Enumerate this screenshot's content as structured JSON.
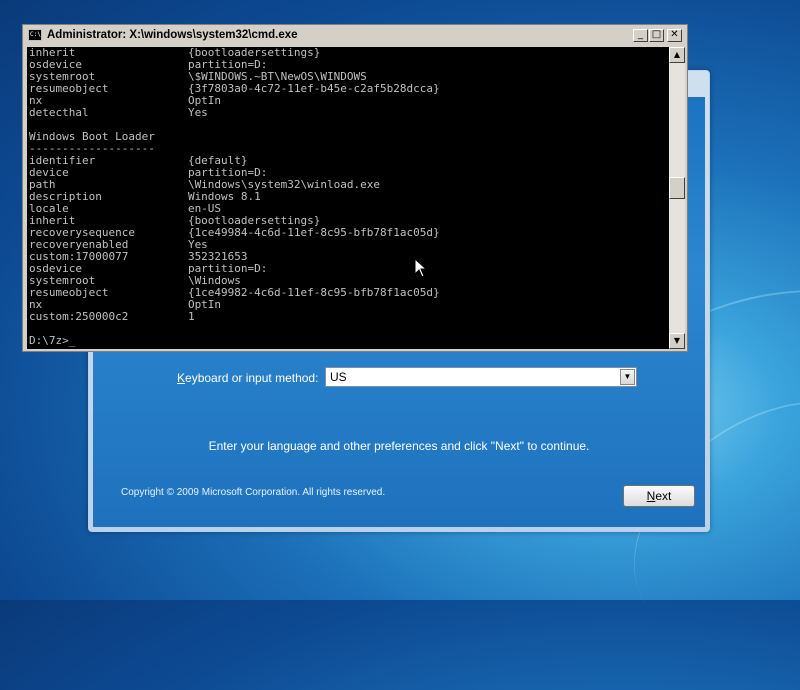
{
  "cmd_window": {
    "title": "Administrator: X:\\windows\\system32\\cmd.exe",
    "icon_text": "C:\\",
    "controls": {
      "minimize": "_",
      "maximize": "□",
      "close": "✕"
    },
    "scroll_up": "▲",
    "scroll_down": "▼",
    "lines": [
      "inherit                 {bootloadersettings}",
      "osdevice                partition=D:",
      "systemroot              \\$WINDOWS.~BT\\NewOS\\WINDOWS",
      "resumeobject            {3f7803a0-4c72-11ef-b45e-c2af5b28dcca}",
      "nx                      OptIn",
      "detecthal               Yes",
      "",
      "Windows Boot Loader",
      "-------------------",
      "identifier              {default}",
      "device                  partition=D:",
      "path                    \\Windows\\system32\\winload.exe",
      "description             Windows 8.1",
      "locale                  en-US",
      "inherit                 {bootloadersettings}",
      "recoverysequence        {1ce49984-4c6d-11ef-8c95-bfb78f1ac05d}",
      "recoveryenabled         Yes",
      "custom:17000077         352321653",
      "osdevice                partition=D:",
      "systemroot              \\Windows",
      "resumeobject            {1ce49982-4c6d-11ef-8c95-bfb78f1ac05d}",
      "nx                      OptIn",
      "custom:250000c2         1",
      "",
      "D:\\7z>_"
    ]
  },
  "setup_window": {
    "keyboard_label_prefix": "K",
    "keyboard_label_rest": "eyboard or input method:",
    "keyboard_value": "US",
    "dropdown_arrow": "▼",
    "hint": "Enter your language and other preferences and click \"Next\" to continue.",
    "copyright": "Copyright © 2009 Microsoft Corporation. All rights reserved.",
    "next_mnemonic": "N",
    "next_rest": "ext"
  }
}
